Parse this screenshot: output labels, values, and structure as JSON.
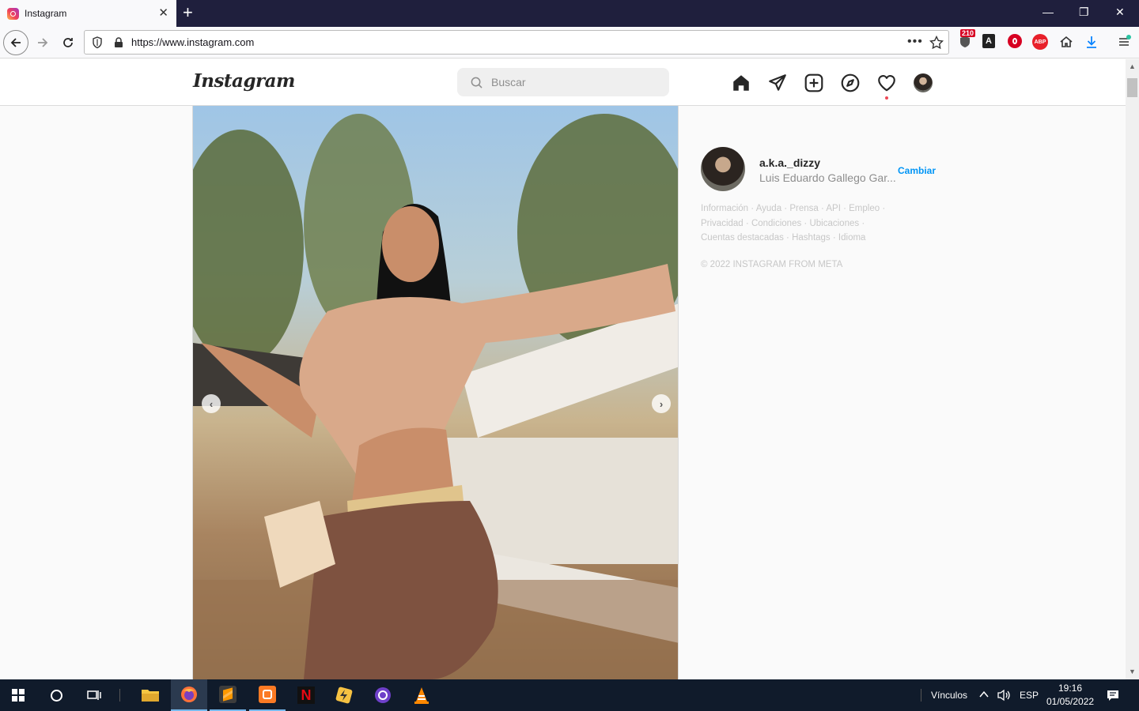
{
  "browser": {
    "tab_title": "Instagram",
    "url": "https://www.instagram.com",
    "ext_badge": "210",
    "abp_label": "ABP"
  },
  "instagram": {
    "logo": "Instagram",
    "search_placeholder": "Buscar"
  },
  "sidebar": {
    "username": "a.k.a._dizzy",
    "full_name": "Luis Eduardo Gallego Gar...",
    "switch_label": "Cambiar",
    "footer_links": [
      "Información",
      "Ayuda",
      "Prensa",
      "API",
      "Empleo",
      "Privacidad",
      "Condiciones",
      "Ubicaciones",
      "Cuentas destacadas",
      "Hashtags",
      "Idioma"
    ],
    "copyright": "© 2022 INSTAGRAM FROM META"
  },
  "taskbar": {
    "links_label": "Vínculos",
    "language": "ESP",
    "time": "19:16",
    "date": "01/05/2022"
  },
  "colors": {
    "accent": "#0095f6",
    "notification_dot": "#ed4956",
    "taskbar": "#101b2b"
  }
}
